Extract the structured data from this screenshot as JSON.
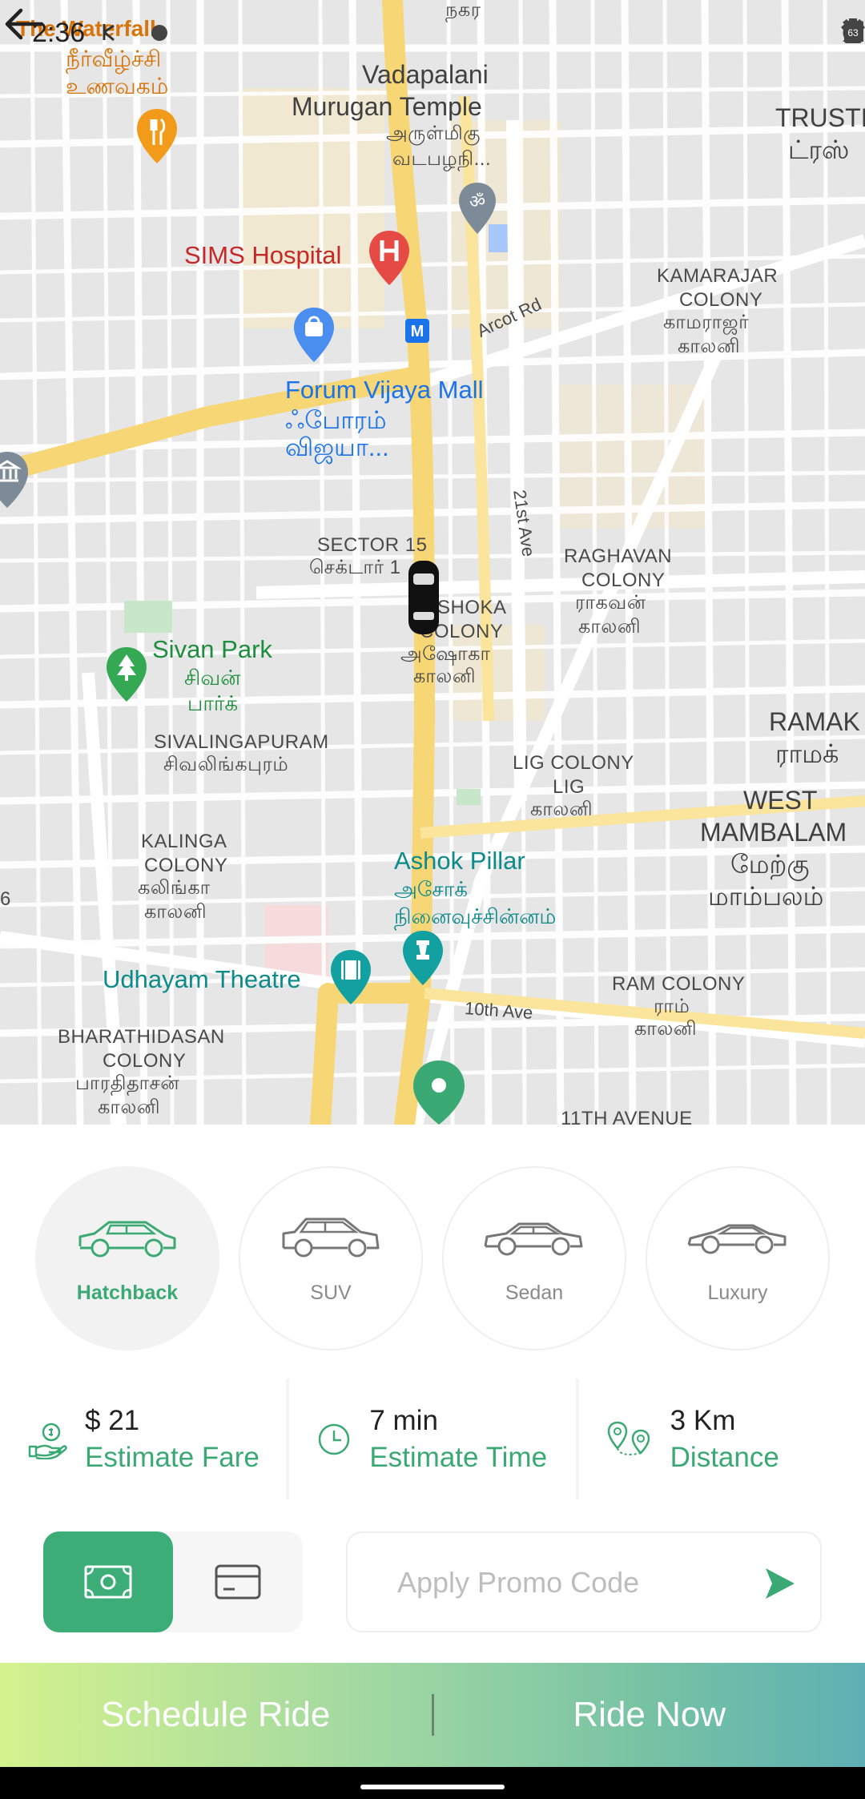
{
  "status_bar": {
    "time": "2:36",
    "battery": "63",
    "icons": [
      "alarm-icon",
      "wifi-icon",
      "signal-icon",
      "battery-icon"
    ]
  },
  "map": {
    "labels": {
      "waterfall_en": "The Waterfall",
      "waterfall_ta1": "நீர்வீழ்ச்சி",
      "waterfall_ta2": "உணவகம்",
      "nagar": "நகர",
      "vadapalani1": "Vadapalani",
      "vadapalani2": "Murugan Temple",
      "vadapalani_ta1": "அருள்மிகு",
      "vadapalani_ta2": "வடபழநி...",
      "trust1": "TRUSTI",
      "trust2": "ட்ரஸ்",
      "sims": "SIMS Hospital",
      "kamarajar1": "KAMARAJAR",
      "kamarajar2": "COLONY",
      "kamarajar_ta1": "காமராஜர்",
      "kamarajar_ta2": "காலனி",
      "arcot_rd": "Arcot Rd",
      "forum1": "Forum Vijaya Mall",
      "forum_ta1": "ஃபோரம்",
      "forum_ta2": "விஜயா...",
      "ave21": "21st Ave",
      "sector1": "SECTOR 15",
      "sector_ta": "செக்டார் 1",
      "ashoka1": "SHOKA",
      "ashoka2": "COLONY",
      "ashoka_ta1": "அஷோகா",
      "ashoka_ta2": "காலனி",
      "raghavan1": "RAGHAVAN",
      "raghavan2": "COLONY",
      "raghavan_ta1": "ராகவன்",
      "raghavan_ta2": "காலனி",
      "sivan1": "Sivan Park",
      "sivan_ta1": "சிவன்",
      "sivan_ta2": "பார்க்",
      "sivalinga1": "SIVALINGAPURAM",
      "sivalinga_ta": "சிவலிங்கபுரம்",
      "ramak1": "RAMAK",
      "ramak_ta": "ராமக்",
      "lig1": "LIG COLONY",
      "lig2": "LIG",
      "lig_ta": "காலனி",
      "west1": "WEST",
      "west2": "MAMBALAM",
      "west_ta1": "மேற்கு",
      "west_ta2": "மாம்பலம்",
      "kalinga1": "KALINGA",
      "kalinga2": "COLONY",
      "kalinga_ta1": "கலிங்கா",
      "kalinga_ta2": "காலனி",
      "ashok_pillar": "Ashok Pillar",
      "ashok_ta1": "அசோக்",
      "ashok_ta2": "நினைவுச்சின்னம்",
      "udhayam": "Udhayam Theatre",
      "ram1": "RAM COLONY",
      "ram_ta1": "ராம்",
      "ram_ta2": "காலனி",
      "ave10": "10th Ave",
      "bharathi1": "BHARATHIDASAN",
      "bharathi2": "COLONY",
      "bharathi_ta1": "பாரதிதாசன்",
      "bharathi_ta2": "காலனி",
      "ave11": "11TH AVENUE",
      "six": "6"
    }
  },
  "vehicles": [
    {
      "label": "Hatchback",
      "selected": true
    },
    {
      "label": "SUV",
      "selected": false
    },
    {
      "label": "Sedan",
      "selected": false
    },
    {
      "label": "Luxury",
      "selected": false
    }
  ],
  "estimates": {
    "fare_value": "$ 21",
    "fare_label": "Estimate Fare",
    "time_value": "7 min",
    "time_label": "Estimate Time",
    "distance_value": "3 Km",
    "distance_label": "Distance"
  },
  "payment": {
    "selected": "cash"
  },
  "promo": {
    "placeholder": "Apply Promo Code",
    "value": ""
  },
  "actions": {
    "schedule": "Schedule Ride",
    "ride_now": "Ride Now"
  },
  "colors": {
    "accent": "#3dad78",
    "gradient_start": "#d4f28e",
    "gradient_end": "#5eb0b4"
  }
}
